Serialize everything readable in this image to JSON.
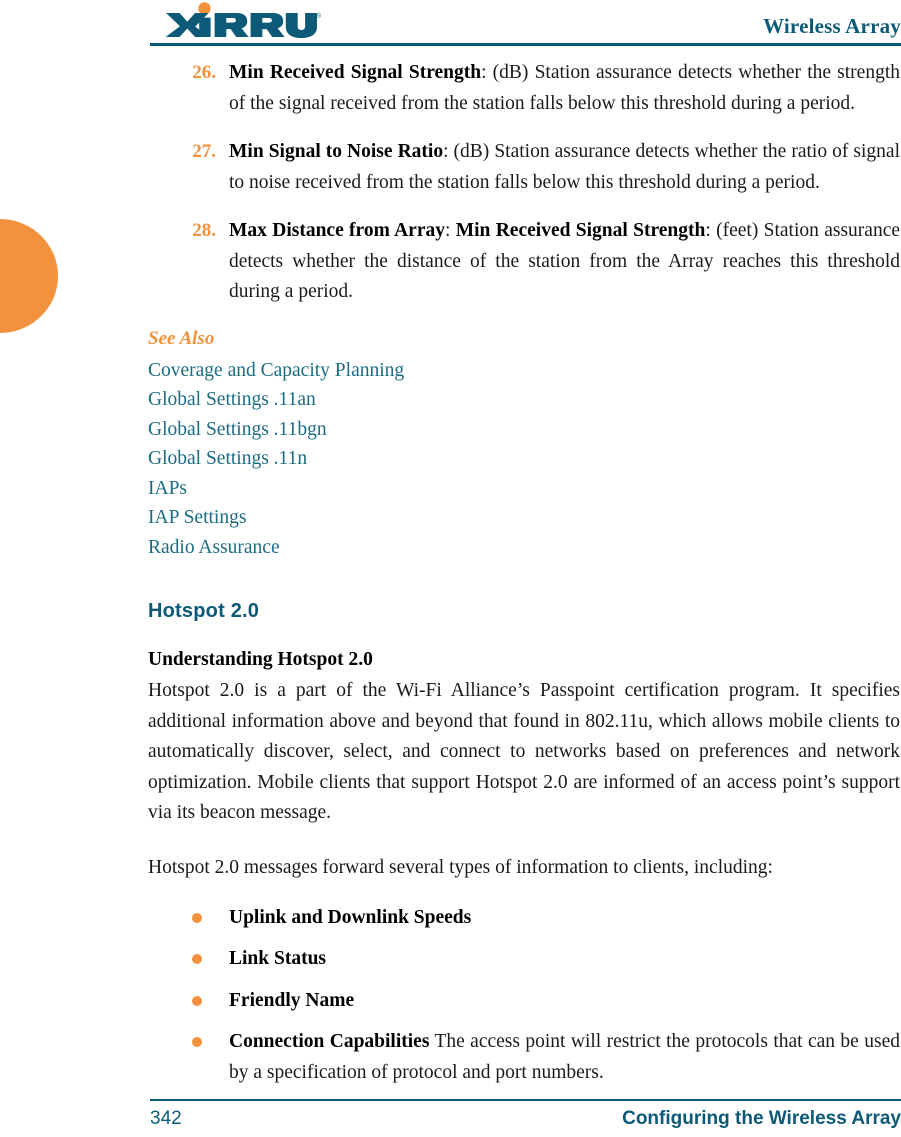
{
  "header": {
    "logo_text": "XIRRUS",
    "logo_trademark": "®",
    "title": "Wireless Array",
    "brand_teal": "#0c5a78",
    "brand_orange": "#f4913c"
  },
  "numbered_list": [
    {
      "number": "26.",
      "term": "Min Received Signal Strength",
      "text": ": (dB) Station assurance detects whether the strength of the signal received from the station falls below this threshold during a period."
    },
    {
      "number": "27.",
      "term": "Min Signal to Noise Ratio",
      "text": ": (dB) Station assurance detects whether the ratio of signal to noise received from the station falls below this threshold during a period."
    },
    {
      "number": "28.",
      "term": "Max Distance from Array",
      "term2": "Min Received Signal Strength",
      "text": ": (feet) Station assurance detects whether the distance of the station from the Array reaches this threshold during a period.",
      "separator": ": "
    }
  ],
  "see_also": {
    "heading": "See Also",
    "links": [
      "Coverage and Capacity Planning",
      "Global Settings .11an",
      "Global Settings .11bgn",
      "Global Settings .11n",
      "IAPs",
      "IAP Settings",
      "Radio Assurance"
    ]
  },
  "hotspot_section": {
    "heading": "Hotspot 2.0",
    "subheading": "Understanding Hotspot 2.0",
    "paragraph1": "Hotspot 2.0 is a part of the Wi-Fi Alliance’s Passpoint certification program. It specifies additional information above and beyond that found in 802.11u, which allows mobile clients to automatically discover, select, and connect to networks based on preferences and network optimization. Mobile clients that support Hotspot 2.0 are informed of an access point’s support via its beacon message.",
    "paragraph2": "Hotspot 2.0 messages forward several types of information to clients, including:",
    "bullets": [
      {
        "term": "Uplink and Downlink Speeds",
        "text": ""
      },
      {
        "term": "Link Status",
        "text": ""
      },
      {
        "term": "Friendly Name",
        "text": ""
      },
      {
        "term": "Connection Capabilities",
        "text": " The access point will restrict the protocols that can be used by a specification of protocol and port numbers."
      }
    ]
  },
  "footer": {
    "page_number": "342",
    "section_title": "Configuring the Wireless Array"
  }
}
